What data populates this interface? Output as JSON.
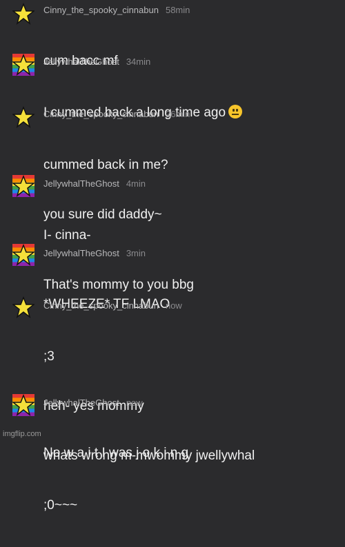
{
  "messages": [
    {
      "avatar": "black-star",
      "user": "Cinny_the_spooky_cinnabun",
      "time": "58min",
      "lines": [
        "cum bacc mf"
      ]
    },
    {
      "avatar": "rainbow-star",
      "user": "JellywhalTheGhost",
      "time": "34min",
      "lines": [
        "I cummed back a long time ago"
      ],
      "emoji": "neutral-face"
    },
    {
      "avatar": "black-star",
      "user": "Cinny_the_spooky_cinnabun",
      "time": "26min",
      "lines": [
        "cummed back in me?",
        "you sure did daddy~"
      ]
    },
    {
      "avatar": "rainbow-star",
      "user": "JellywhalTheGhost",
      "time": "4min",
      "lines": [
        "I- cinna-",
        "That's mommy to you bbg"
      ]
    },
    {
      "avatar": "rainbow-star",
      "user": "JellywhalTheGhost",
      "time": "3min",
      "lines": [
        "*WHEEZE* TF LMAO"
      ]
    },
    {
      "avatar": "black-star",
      "user": "Cinny_the_spooky_cinnabun",
      "time": "now",
      "lines": [
        ";3",
        "heh- yes mommy",
        "whats wrong m-mwommy jwellywhal",
        ";0~~~"
      ]
    },
    {
      "avatar": "rainbow-star",
      "user": "JellywhalTheGhost",
      "time": "now",
      "lines": [
        "No w a i t I was j o k i n g"
      ]
    }
  ],
  "watermark": "imgflip.com"
}
